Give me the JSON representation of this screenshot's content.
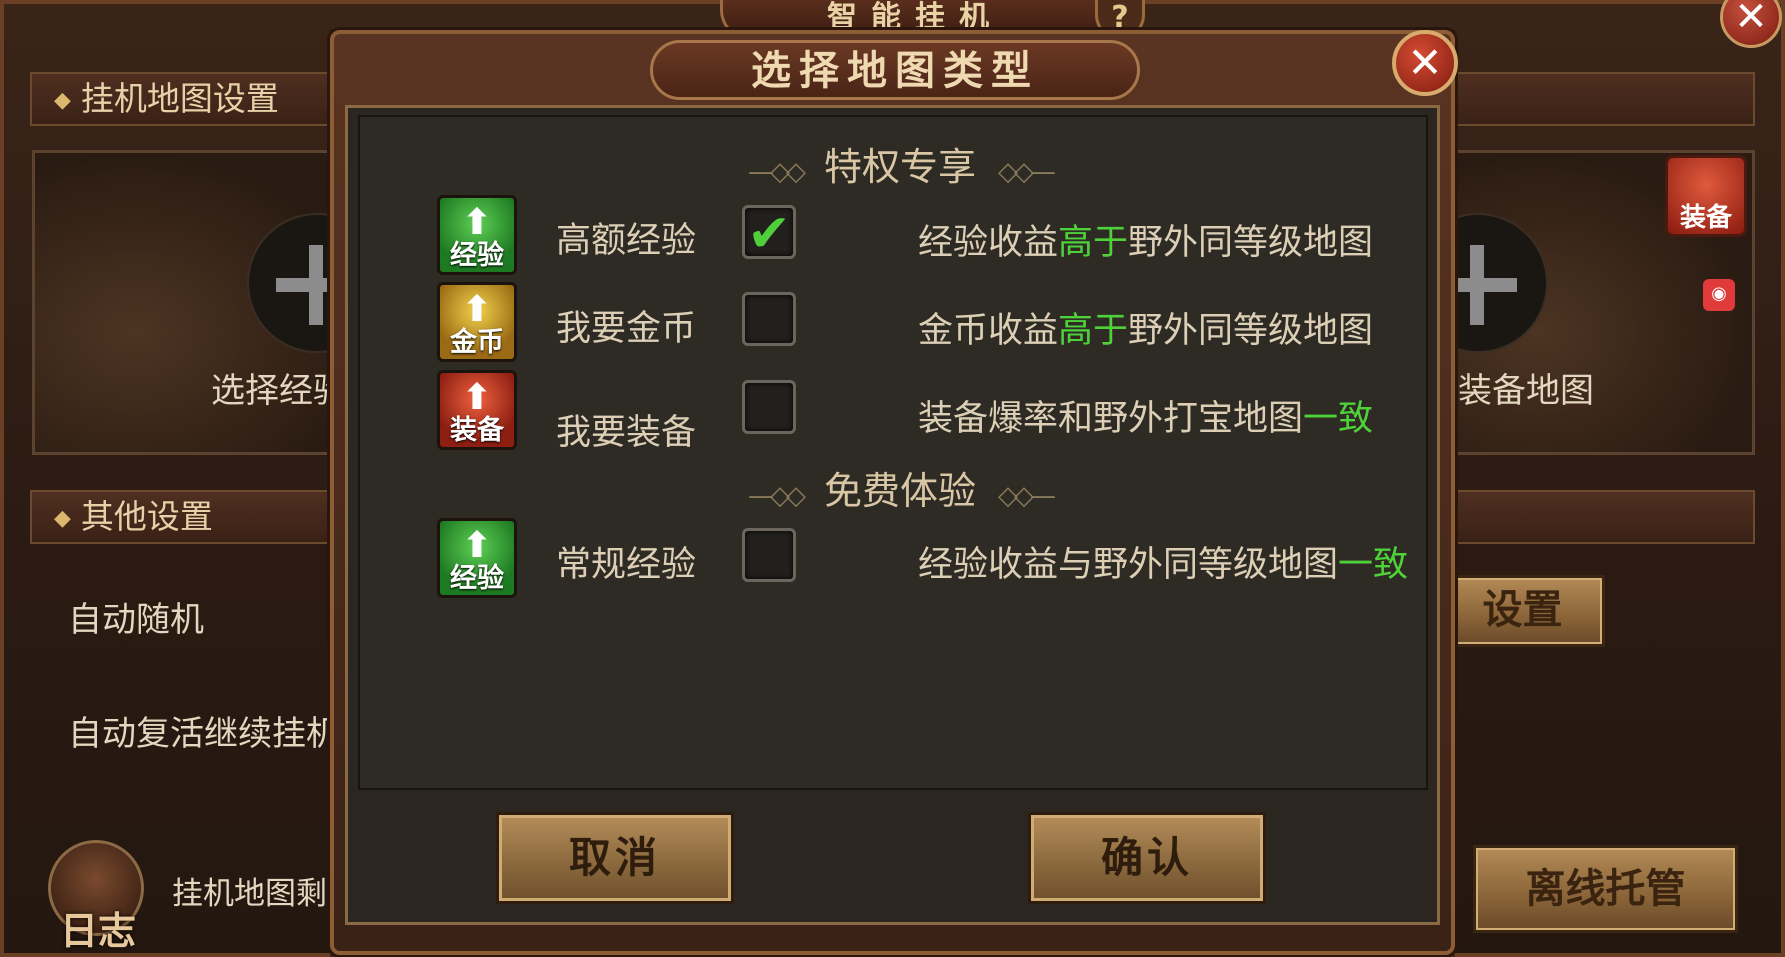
{
  "background_window": {
    "title": "智能挂机",
    "help_label": "?",
    "close_label": "✕",
    "map_settings_header": "挂机地图设置",
    "select_exp_map": "选择经验",
    "equip_map": "装备地图",
    "equip_badge": "装备",
    "other_settings_header": "其他设置",
    "auto_random": "自动随机",
    "auto_revive": "自动复活继续挂机",
    "settings_button": "设置",
    "map_remaining": "挂机地图剩",
    "log_label": "日志",
    "offline_button": "离线托管",
    "red_badge_icon": "notification-icon"
  },
  "modal": {
    "title": "选择地图类型",
    "close_label": "✕",
    "section_privilege": "特权专享",
    "section_free": "免费体验",
    "ornament_left": "—◇◇",
    "ornament_right": "◇◇—",
    "options": [
      {
        "icon_label": "经验",
        "icon_color": "green",
        "label": "高额经验",
        "checked": true,
        "checkmark": "✔",
        "desc_pre": "经验收益",
        "desc_hl": "高于",
        "desc_post": "野外同等级地图"
      },
      {
        "icon_label": "金币",
        "icon_color": "gold",
        "label": "我要金币",
        "checked": false,
        "checkmark": "",
        "desc_pre": "金币收益",
        "desc_hl": "高于",
        "desc_post": "野外同等级地图"
      },
      {
        "icon_label": "装备",
        "icon_color": "red",
        "label": "我要装备",
        "checked": false,
        "checkmark": "",
        "desc_pre": "装备爆率和野外打宝地图",
        "desc_hl": "一致",
        "desc_post": ""
      },
      {
        "icon_label": "经验",
        "icon_color": "green",
        "label": "常规经验",
        "checked": false,
        "checkmark": "",
        "desc_pre": "经验收益与野外同等级地图",
        "desc_hl": "一致",
        "desc_post": ""
      }
    ],
    "cancel_label": "取消",
    "confirm_label": "确认"
  },
  "colors": {
    "highlight_green": "#4fd13a",
    "frame_brown": "#8d5e36",
    "button_gold": "#b58d5a"
  }
}
